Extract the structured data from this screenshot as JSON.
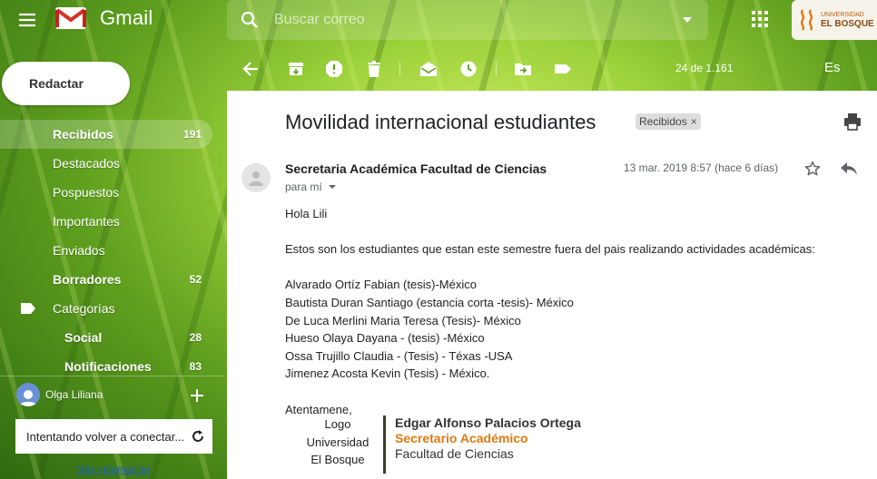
{
  "app": {
    "name": "Gmail"
  },
  "search": {
    "placeholder": "Buscar correo"
  },
  "org": {
    "small": "UNIVERSIDAD",
    "big": "EL BOSQUE"
  },
  "compose": {
    "label": "Redactar"
  },
  "nav": {
    "items": [
      {
        "label": "Recibidos",
        "count": "191"
      },
      {
        "label": "Destacados",
        "count": ""
      },
      {
        "label": "Pospuestos",
        "count": ""
      },
      {
        "label": "Importantes",
        "count": ""
      },
      {
        "label": "Enviados",
        "count": ""
      },
      {
        "label": "Borradores",
        "count": "52"
      },
      {
        "label": "Categorías",
        "count": ""
      },
      {
        "label": "Social",
        "count": "28"
      },
      {
        "label": "Notificaciones",
        "count": "83"
      }
    ]
  },
  "hangouts": {
    "user": "Olga Liliana",
    "reconnect": "Intentando volver a conectar...",
    "more_info": "Más información"
  },
  "toolbar": {
    "pager": "24 de 1.161",
    "lang": "Es"
  },
  "message": {
    "subject": "Movilidad internacional estudiantes",
    "label": "Recibidos",
    "label_close": "×",
    "sender": "Secretaria Académica Facultad de Ciencias",
    "recipient": "para mí",
    "date": "13 mar. 2019 8:57 (hace 6 días)",
    "greeting": "Hola Lili",
    "intro": "Estos son los estudiantes que estan este semestre fuera del pais realizando actividades académicas:",
    "students": [
      "Alvarado Ortíz Fabian (tesis)-México",
      "Bautista Duran Santiago (estancia corta -tesis)- México",
      "De Luca Merlini Maria Teresa (Tesis)- México",
      "Hueso Olaya Dayana - (tesis) -México",
      "Ossa Trujillo Claudia - (Tesis) - Téxas -USA",
      "Jimenez Acosta Kevin (Tesis) - México."
    ],
    "closing": "Atentamene,",
    "signature": {
      "logo_lines": [
        "Logo",
        "Universidad",
        "El Bosque"
      ],
      "name": "Edgar Alfonso Palacios Ortega",
      "title": "Secretario Académico",
      "dept": "Facultad de Ciencias"
    }
  },
  "colors": {
    "accent_orange": "#e07a10",
    "gmail_red": "#d93025",
    "link_blue": "#1a5ec4"
  }
}
